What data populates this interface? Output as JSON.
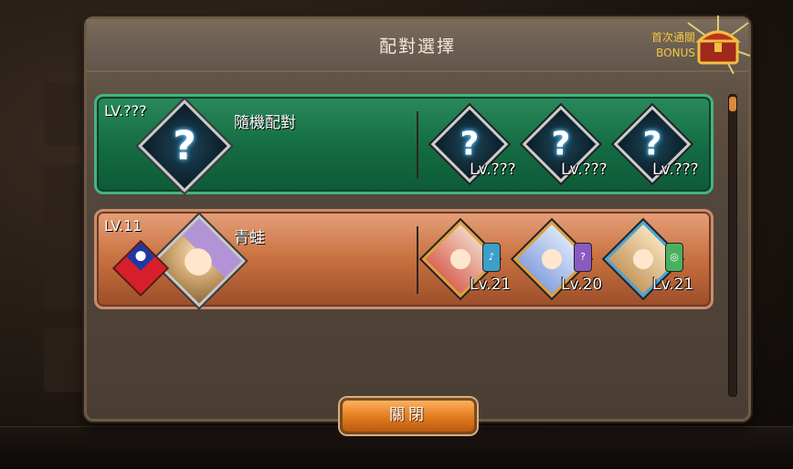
{
  "dialog": {
    "title": "配對選擇",
    "bonus_line1": "首次通關",
    "bonus_line2": "BONUS",
    "close_label": "關閉"
  },
  "random_match": {
    "level": "LV.???",
    "name": "隨機配對",
    "portrait_icon": "question-mark-icon",
    "team": [
      {
        "level": "Lv.???",
        "icon": "question-mark-icon"
      },
      {
        "level": "Lv.???",
        "icon": "question-mark-icon"
      },
      {
        "level": "Lv.???",
        "icon": "question-mark-icon"
      }
    ]
  },
  "opponent": {
    "level": "LV.11",
    "name": "青蛙",
    "flag_icon": "taiwan-flag-icon",
    "team": [
      {
        "level": "Lv.21",
        "element": "blue"
      },
      {
        "level": "Lv.20",
        "element": "purple"
      },
      {
        "level": "Lv.21",
        "element": "green"
      }
    ]
  },
  "colors": {
    "random_row": "#136b43",
    "opponent_row": "#c8703f",
    "bonus_text": "#f2c744",
    "close_button": "#e07a1c"
  }
}
